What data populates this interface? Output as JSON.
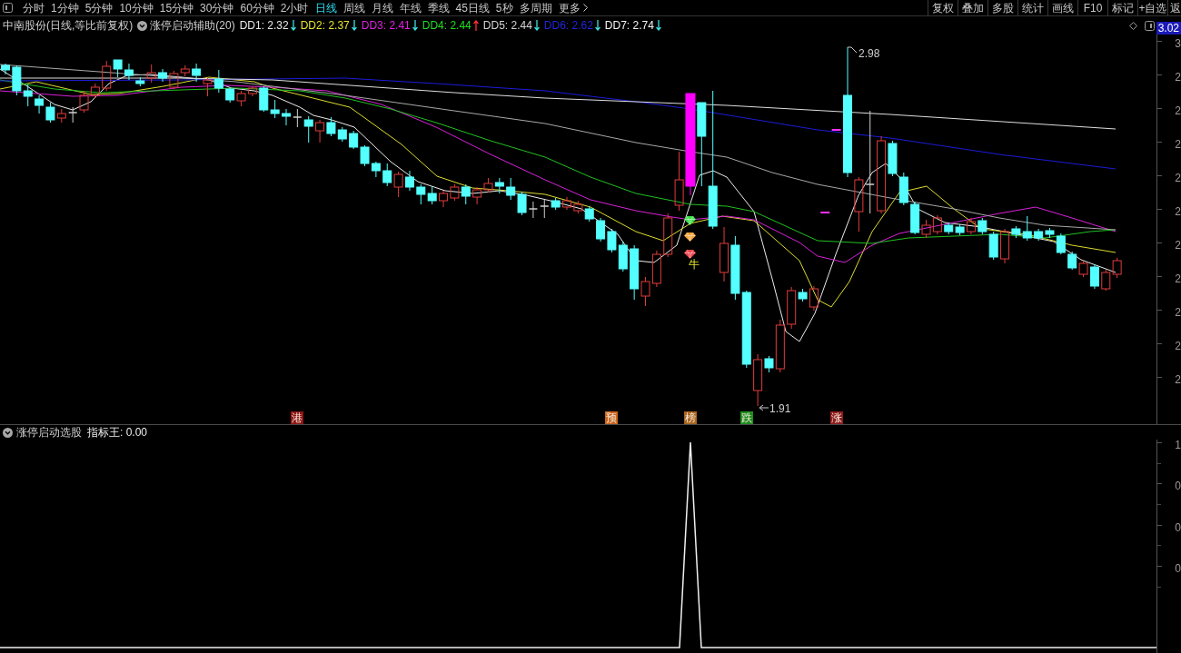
{
  "toolbar": {
    "periods": [
      {
        "label": "分时",
        "selected": false
      },
      {
        "label": "1分钟",
        "selected": false
      },
      {
        "label": "5分钟",
        "selected": false
      },
      {
        "label": "10分钟",
        "selected": false
      },
      {
        "label": "15分钟",
        "selected": false
      },
      {
        "label": "30分钟",
        "selected": false
      },
      {
        "label": "60分钟",
        "selected": false
      },
      {
        "label": "2小时",
        "selected": false
      },
      {
        "label": "日线",
        "selected": true
      },
      {
        "label": "周线",
        "selected": false
      },
      {
        "label": "月线",
        "selected": false
      },
      {
        "label": "年线",
        "selected": false
      },
      {
        "label": "季线",
        "selected": false
      },
      {
        "label": "45日线",
        "selected": false
      },
      {
        "label": "5秒",
        "selected": false
      },
      {
        "label": "多周期",
        "selected": false
      }
    ],
    "more": "更多",
    "buttons": [
      "复权",
      "叠加",
      "多股",
      "统计",
      "画线",
      "F10",
      "标记",
      "+自选",
      "返"
    ]
  },
  "info_bar": {
    "title": "中南股份(日线,等比前复权)",
    "indicator": "涨停启动辅助(20)",
    "values": [
      {
        "label": "DD1: 2.32",
        "color": "#e8e8e8",
        "rising": false
      },
      {
        "label": "DD2: 2.37",
        "color": "#e6e62e",
        "rising": false
      },
      {
        "label": "DD3: 2.41",
        "color": "#e020e0",
        "rising": false
      },
      {
        "label": "DD4: 2.44",
        "color": "#22dd22",
        "rising": true
      },
      {
        "label": "DD5: 2.44",
        "color": "#d4d4d4",
        "rising": false
      },
      {
        "label": "DD6: 2.62",
        "color": "#2424e0",
        "rising": false
      },
      {
        "label": "DD7: 2.74",
        "color": "#f4f4f4",
        "rising": false
      }
    ],
    "price_label": "3.02"
  },
  "main_chart": {
    "annotations": [
      {
        "kind": "high",
        "text": "2.98"
      },
      {
        "kind": "low",
        "text": "1.91"
      }
    ],
    "signals": [
      {
        "color": "#3ee04a"
      },
      {
        "color": "#f2a33a"
      },
      {
        "color": "#f0404a"
      }
    ],
    "signal_text": "牛",
    "events": [
      {
        "text": "港",
        "color": "#8e1616"
      },
      {
        "text": "预",
        "color": "#c8641c"
      },
      {
        "text": "榜",
        "color": "#a8641e"
      },
      {
        "text": "跌",
        "color": "#1e8e1e"
      },
      {
        "text": "涨",
        "color": "#8e1c1c"
      }
    ],
    "axis_labels": [
      "3",
      "2",
      "2",
      "2",
      "2",
      "2",
      "2",
      "2",
      "2",
      "2",
      "2"
    ]
  },
  "sub_chart": {
    "title": "涨停启动选股",
    "value": "指标王: 0.00",
    "axis_labels": [
      "1",
      "0",
      "0",
      "0"
    ]
  }
}
